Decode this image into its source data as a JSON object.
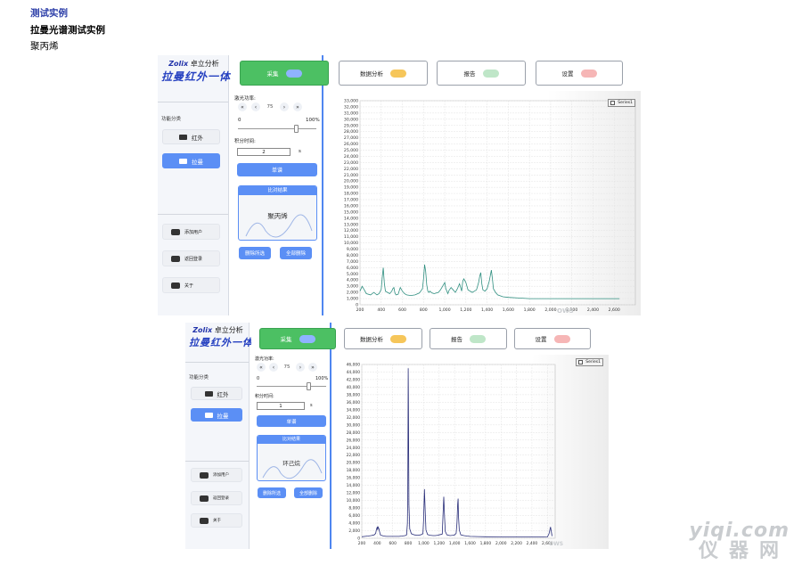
{
  "heading": {
    "title": "测试实例",
    "subtitle": "拉曼光谱测试实例",
    "sample": "聚丙烯"
  },
  "app": {
    "brand": "Zolix",
    "brand_cn": "卓立分析",
    "product": "拉曼红外一体机",
    "section_label": "功能分类",
    "nav": [
      {
        "label": "红外",
        "icon": "box-icon"
      },
      {
        "label": "拉曼",
        "icon": "layers-icon"
      }
    ],
    "bottom": [
      {
        "label": "添加用户",
        "icon": "users-icon"
      },
      {
        "label": "返回登录",
        "icon": "exit-icon"
      },
      {
        "label": "关于",
        "icon": "info-icon"
      }
    ],
    "toolbar": [
      {
        "label": "采集",
        "active": true
      },
      {
        "label": "数据分析"
      },
      {
        "label": "报告"
      },
      {
        "label": "设置"
      }
    ],
    "laser_label": "激光功率:",
    "power_value": "75",
    "stepper_buttons": [
      "«",
      "‹",
      "›",
      "»"
    ],
    "slider_min": "0",
    "slider_max": "100%",
    "integration_label": "积分时间:",
    "integration_unit": "s",
    "scan_button": "单谱",
    "result_header": "比对结果",
    "delete_selected": "删除所选",
    "delete_all": "全部删除"
  },
  "shots": [
    {
      "integration_value": "2",
      "result_name": "聚丙烯",
      "legend": "Series1",
      "watermark": "OWS"
    },
    {
      "integration_value": "1",
      "result_name": "环己烷",
      "legend": "Series1",
      "watermark": "OWS"
    }
  ],
  "chart_data": [
    {
      "type": "line",
      "xlim": [
        200,
        2800
      ],
      "ylim": [
        0,
        33000
      ],
      "xticks": [
        200,
        400,
        600,
        800,
        1000,
        1200,
        1400,
        1600,
        1800,
        2000,
        2200,
        2400,
        2600
      ],
      "ystep": 1000,
      "grid": true,
      "legend": "top-right",
      "x": [
        200,
        220,
        240,
        260,
        300,
        330,
        360,
        380,
        400,
        410,
        420,
        430,
        440,
        460,
        480,
        500,
        510,
        520,
        530,
        540,
        560,
        580,
        600,
        620,
        640,
        680,
        720,
        760,
        790,
        800,
        810,
        820,
        830,
        840,
        850,
        860,
        880,
        900,
        940,
        960,
        980,
        1000,
        1010,
        1020,
        1030,
        1040,
        1060,
        1080,
        1100,
        1120,
        1140,
        1150,
        1160,
        1170,
        1180,
        1200,
        1220,
        1260,
        1280,
        1300,
        1320,
        1330,
        1340,
        1350,
        1360,
        1380,
        1400,
        1420,
        1440,
        1450,
        1460,
        1480,
        1500,
        1550,
        1600,
        1700,
        1800,
        2000,
        2200,
        2400,
        2600,
        2650
      ],
      "y": [
        2200,
        3000,
        2400,
        1800,
        1600,
        2000,
        1600,
        1800,
        2500,
        4500,
        6000,
        3500,
        2200,
        2000,
        1800,
        2200,
        2600,
        2800,
        1900,
        1600,
        1700,
        2800,
        2200,
        1800,
        1600,
        1500,
        1600,
        1900,
        2600,
        4200,
        6500,
        5400,
        3200,
        2200,
        2000,
        2200,
        1900,
        1800,
        2000,
        2400,
        3000,
        3600,
        2600,
        2200,
        1800,
        2300,
        2800,
        2400,
        2000,
        2600,
        3400,
        2800,
        2200,
        3800,
        4200,
        3600,
        2400,
        2000,
        2200,
        2400,
        3600,
        4600,
        5200,
        3400,
        2400,
        2200,
        2600,
        3800,
        5600,
        4200,
        2600,
        2000,
        1600,
        1300,
        1200,
        1100,
        1000,
        1000,
        1000,
        1000,
        1000,
        1000
      ]
    },
    {
      "type": "line",
      "xlim": [
        200,
        2700
      ],
      "ylim": [
        0,
        46000
      ],
      "xticks": [
        200,
        400,
        600,
        800,
        1000,
        1200,
        1400,
        1600,
        1800,
        2000,
        2200,
        2400,
        2600
      ],
      "ystep": 2000,
      "grid": true,
      "legend": "top-right",
      "x": [
        200,
        240,
        280,
        320,
        360,
        380,
        390,
        400,
        405,
        410,
        420,
        440,
        480,
        520,
        560,
        600,
        640,
        680,
        720,
        760,
        780,
        790,
        795,
        800,
        802,
        810,
        820,
        840,
        880,
        920,
        960,
        990,
        1000,
        1010,
        1020,
        1030,
        1050,
        1080,
        1120,
        1150,
        1180,
        1200,
        1240,
        1250,
        1260,
        1270,
        1280,
        1300,
        1340,
        1380,
        1400,
        1420,
        1430,
        1440,
        1445,
        1450,
        1460,
        1480,
        1520,
        1560,
        1600,
        1700,
        1800,
        2000,
        2200,
        2400,
        2500,
        2550,
        2600,
        2620,
        2640,
        2660
      ],
      "y": [
        400,
        500,
        600,
        700,
        900,
        1300,
        2400,
        3000,
        2200,
        3000,
        2600,
        900,
        600,
        500,
        500,
        500,
        500,
        500,
        600,
        700,
        900,
        4000,
        12000,
        45000,
        38000,
        9000,
        2500,
        1200,
        900,
        800,
        900,
        1200,
        5000,
        13000,
        7000,
        2200,
        1000,
        800,
        700,
        700,
        800,
        900,
        1100,
        6000,
        11000,
        5500,
        1800,
        900,
        700,
        800,
        900,
        1300,
        4000,
        9000,
        10500,
        6000,
        2200,
        900,
        700,
        600,
        500,
        450,
        400,
        380,
        360,
        340,
        330,
        330,
        350,
        1200,
        3000,
        600
      ]
    }
  ]
}
